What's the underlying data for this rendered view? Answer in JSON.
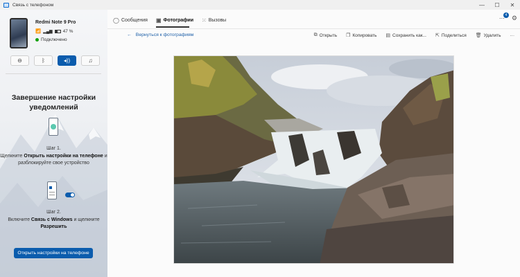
{
  "window": {
    "title": "Связь с телефоном",
    "controls": {
      "minimize": "—",
      "maximize": "☐",
      "close": "✕"
    }
  },
  "device": {
    "name": "Redmi Note 9 Pro",
    "battery": "47 %",
    "connection_status": "Подключено",
    "status_color": "#13a10e"
  },
  "quick_actions": [
    {
      "icon": "do-not-disturb-icon",
      "glyph": "⊖"
    },
    {
      "icon": "bluetooth-icon",
      "glyph": "ᛒ"
    },
    {
      "icon": "audio-icon",
      "glyph": "🔊",
      "active": true
    },
    {
      "icon": "music-icon",
      "glyph": "♫"
    }
  ],
  "setup": {
    "title": "Завершение настройки уведомлений",
    "step1": {
      "label": "Шаг 1.",
      "text_before": "Щелкните",
      "bold": "Открыть настройки на телефоне",
      "text_after": "и разблокируйте свое устройство"
    },
    "step2": {
      "label": "Шаг 2.",
      "text_before": "Включите",
      "bold1": "Связь с Windows",
      "text_mid": "и щелкните",
      "bold2": "Разрешить"
    },
    "button": "Открыть настройки на телефоне"
  },
  "tabs": [
    {
      "label": "Сообщения",
      "icon": "chat-icon"
    },
    {
      "label": "Фотографии",
      "icon": "photos-icon",
      "active": true
    },
    {
      "label": "Вызовы",
      "icon": "dialpad-icon"
    }
  ],
  "notifications": {
    "count": "4"
  },
  "toolbar": {
    "back": "Вернуться к фотографиям",
    "open": "Открыть",
    "copy": "Копировать",
    "save_as": "Сохранить как...",
    "share": "Поделиться",
    "delete": "Удалить",
    "more": "···"
  },
  "colors": {
    "accent": "#0b5cad",
    "link": "#1d5fa8"
  }
}
